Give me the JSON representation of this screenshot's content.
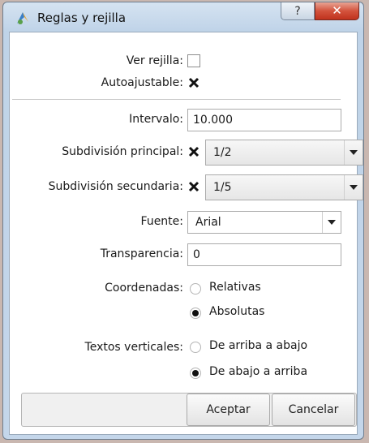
{
  "window": {
    "title": "Reglas y rejilla",
    "help_label": "?",
    "close_label": "✕"
  },
  "grid": {
    "show_label": "Ver rejilla:",
    "show_checked": false,
    "auto_label": "Autoajustable:",
    "auto_checked": true
  },
  "interval": {
    "label": "Intervalo:",
    "value": "10.000"
  },
  "main_subdivision": {
    "label": "Subdivisión principal:",
    "checked": true,
    "value": "1/2"
  },
  "secondary_subdivision": {
    "label": "Subdivisión secundaria:",
    "checked": true,
    "value": "1/5"
  },
  "font": {
    "label": "Fuente:",
    "value": "Arial"
  },
  "transparency": {
    "label": "Transparencia:",
    "value": "0"
  },
  "coordinates": {
    "label": "Coordenadas:",
    "options": [
      "Relativas",
      "Absolutas"
    ],
    "selected": "Absolutas"
  },
  "vertical_texts": {
    "label": "Textos verticales:",
    "options": [
      "De arriba a abajo",
      "De abajo a arriba"
    ],
    "selected": "De abajo a arriba"
  },
  "buttons": {
    "ok": "Aceptar",
    "cancel": "Cancelar"
  }
}
